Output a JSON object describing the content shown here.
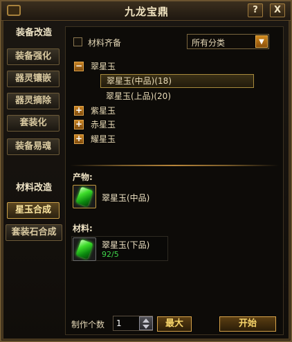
{
  "window": {
    "title": "九龙宝鼎",
    "help_label": "?",
    "close_label": "X"
  },
  "sidebar": {
    "group1": "装备改造",
    "group1_items": [
      "装备强化",
      "器灵镶嵌",
      "器灵摘除",
      "套装化",
      "装备易魂"
    ],
    "group2": "材料改造",
    "group2_items": [
      "星玉合成",
      "套装石合成"
    ],
    "active": "星玉合成"
  },
  "filter": {
    "checkbox_label": "材料齐备",
    "dropdown_value": "所有分类",
    "dropdown_arrow": "▼"
  },
  "tree": {
    "nodes": [
      {
        "label": "翠星玉",
        "toggle": "−",
        "expanded": true,
        "children": [
          "翠星玉(中品)(18)",
          "翠星玉(上品)(20)"
        ]
      },
      {
        "label": "紫星玉",
        "toggle": "+"
      },
      {
        "label": "赤星玉",
        "toggle": "+"
      },
      {
        "label": "耀星玉",
        "toggle": "+"
      }
    ]
  },
  "product": {
    "label": "产物:",
    "name": "翠星玉(中品)"
  },
  "material": {
    "label": "材料:",
    "name": "翠星玉(下品)",
    "count": "92/5"
  },
  "craft": {
    "qty_label": "制作个数",
    "qty_value": "1",
    "max_label": "最大",
    "start_label": "开始"
  },
  "colors": {
    "gem_green": "#3ddc2a",
    "accent_gold": "#d8a44a",
    "count_green": "#3fd64a"
  }
}
